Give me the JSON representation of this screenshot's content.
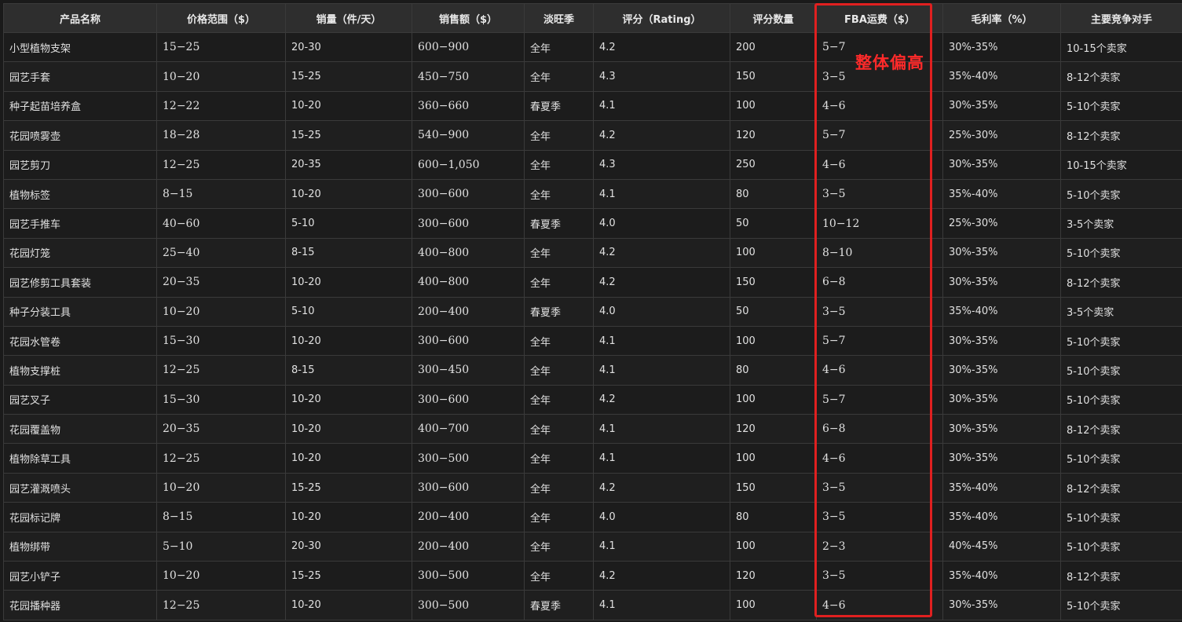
{
  "headers": [
    "产品名称",
    "价格范围（$）",
    "销量（件/天）",
    "销售额（$）",
    "淡旺季",
    "评分（Rating）",
    "评分数量",
    "FBA运费（$）",
    "毛利率（%）",
    "主要竞争对手"
  ],
  "rows": [
    [
      "小型植物支架",
      "15−25",
      "20-30",
      "600−900",
      "全年",
      "4.2",
      "200",
      "5−7",
      "30%-35%",
      "10-15个卖家"
    ],
    [
      "园艺手套",
      "10−20",
      "15-25",
      "450−750",
      "全年",
      "4.3",
      "150",
      "3−5",
      "35%-40%",
      "8-12个卖家"
    ],
    [
      "种子起苗培养盒",
      "12−22",
      "10-20",
      "360−660",
      "春夏季",
      "4.1",
      "100",
      "4−6",
      "30%-35%",
      "5-10个卖家"
    ],
    [
      "花园喷雾壶",
      "18−28",
      "15-25",
      "540−900",
      "全年",
      "4.2",
      "120",
      "5−7",
      "25%-30%",
      "8-12个卖家"
    ],
    [
      "园艺剪刀",
      "12−25",
      "20-35",
      "600−1,050",
      "全年",
      "4.3",
      "250",
      "4−6",
      "30%-35%",
      "10-15个卖家"
    ],
    [
      "植物标签",
      "8−15",
      "10-20",
      "300−600",
      "全年",
      "4.1",
      "80",
      "3−5",
      "35%-40%",
      "5-10个卖家"
    ],
    [
      "园艺手推车",
      "40−60",
      "5-10",
      "300−600",
      "春夏季",
      "4.0",
      "50",
      "10−12",
      "25%-30%",
      "3-5个卖家"
    ],
    [
      "花园灯笼",
      "25−40",
      "8-15",
      "400−800",
      "全年",
      "4.2",
      "100",
      "8−10",
      "30%-35%",
      "5-10个卖家"
    ],
    [
      "园艺修剪工具套装",
      "20−35",
      "10-20",
      "400−800",
      "全年",
      "4.2",
      "150",
      "6−8",
      "30%-35%",
      "8-12个卖家"
    ],
    [
      "种子分装工具",
      "10−20",
      "5-10",
      "200−400",
      "春夏季",
      "4.0",
      "50",
      "3−5",
      "35%-40%",
      "3-5个卖家"
    ],
    [
      "花园水管卷",
      "15−30",
      "10-20",
      "300−600",
      "全年",
      "4.1",
      "100",
      "5−7",
      "30%-35%",
      "5-10个卖家"
    ],
    [
      "植物支撑桩",
      "12−25",
      "8-15",
      "300−450",
      "全年",
      "4.1",
      "80",
      "4−6",
      "30%-35%",
      "5-10个卖家"
    ],
    [
      "园艺叉子",
      "15−30",
      "10-20",
      "300−600",
      "全年",
      "4.2",
      "100",
      "5−7",
      "30%-35%",
      "5-10个卖家"
    ],
    [
      "花园覆盖物",
      "20−35",
      "10-20",
      "400−700",
      "全年",
      "4.1",
      "120",
      "6−8",
      "30%-35%",
      "8-12个卖家"
    ],
    [
      "植物除草工具",
      "12−25",
      "10-20",
      "300−500",
      "全年",
      "4.1",
      "100",
      "4−6",
      "30%-35%",
      "5-10个卖家"
    ],
    [
      "园艺灌溉喷头",
      "10−20",
      "15-25",
      "300−600",
      "全年",
      "4.2",
      "150",
      "3−5",
      "35%-40%",
      "8-12个卖家"
    ],
    [
      "花园标记牌",
      "8−15",
      "10-20",
      "200−400",
      "全年",
      "4.0",
      "80",
      "3−5",
      "35%-40%",
      "5-10个卖家"
    ],
    [
      "植物绑带",
      "5−10",
      "20-30",
      "200−400",
      "全年",
      "4.1",
      "100",
      "2−3",
      "40%-45%",
      "5-10个卖家"
    ],
    [
      "园艺小铲子",
      "10−20",
      "15-25",
      "300−500",
      "全年",
      "4.2",
      "120",
      "3−5",
      "35%-40%",
      "8-12个卖家"
    ],
    [
      "花园播种器",
      "12−25",
      "10-20",
      "300−500",
      "春夏季",
      "4.1",
      "100",
      "4−6",
      "30%-35%",
      "5-10个卖家"
    ]
  ],
  "annotation": "整体偏高",
  "colors": {
    "highlight": "#e02020",
    "annotation_text": "#ff2a2a",
    "header_bg": "#2e2e2e",
    "cell_bg": "#1c1c1c"
  }
}
